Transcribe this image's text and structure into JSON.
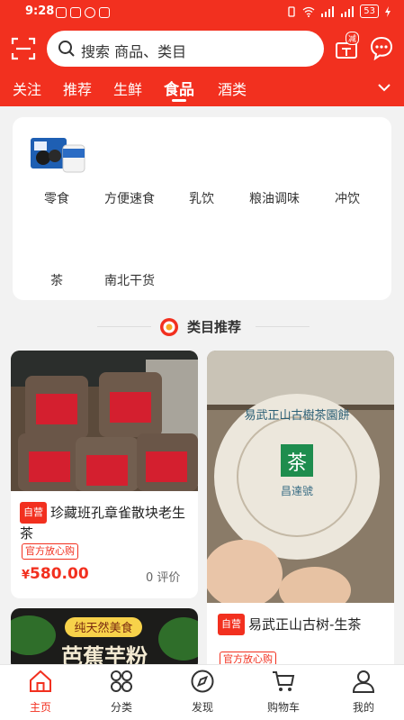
{
  "status_bar": {
    "time": "9:28",
    "battery": "53"
  },
  "search": {
    "placeholder": "搜索 商品、类目"
  },
  "header": {
    "gift_badge": "减"
  },
  "tabs": [
    {
      "label": "关注"
    },
    {
      "label": "推荐"
    },
    {
      "label": "生鲜"
    },
    {
      "label": "食品",
      "active": true
    },
    {
      "label": "酒类"
    }
  ],
  "categories": [
    {
      "label": "零食"
    },
    {
      "label": "方便速食"
    },
    {
      "label": "乳饮"
    },
    {
      "label": "粮油调味"
    },
    {
      "label": "冲饮"
    },
    {
      "label": "茶"
    },
    {
      "label": "南北干货"
    }
  ],
  "section": {
    "title": "类目推荐"
  },
  "products": [
    {
      "badge": "自营",
      "name": "珍藏班孔章雀散块老生茶",
      "tag": "官方放心购",
      "price_symbol": "¥",
      "price": "580.00",
      "reviews": "0 评价"
    },
    {
      "badge": "自营",
      "name": "易武正山古树-生茶",
      "tag": "官方放心购"
    },
    {
      "banner_text": "纯天然美食",
      "name_partial": "芭蕉芋粉"
    }
  ],
  "cake_labels": {
    "ring": "易武正山古樹茶園餅",
    "center": "茶",
    "brand": "昌達號"
  },
  "bottom_nav": [
    {
      "label": "主页",
      "active": true
    },
    {
      "label": "分类"
    },
    {
      "label": "发现"
    },
    {
      "label": "购物车"
    },
    {
      "label": "我的"
    }
  ],
  "colors": {
    "brand_red": "#f2301f",
    "background": "#f2f2f2",
    "price_red": "#f2301f"
  }
}
